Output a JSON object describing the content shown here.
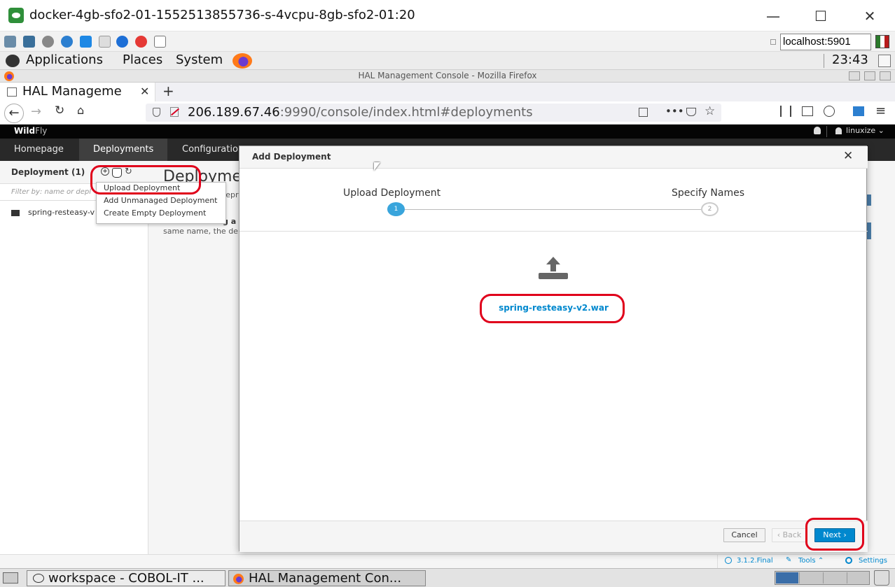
{
  "window": {
    "title": "docker-4gb-sfo2-01-1552513855736-s-4vcpu-8gb-sfo2-01:20",
    "minimize": "—",
    "maximize": "☐",
    "close": "✕"
  },
  "vnc": {
    "host": "localhost:5901"
  },
  "gnome_panel": {
    "menus": [
      "Applications",
      "Places",
      "System"
    ],
    "clock": "23:43"
  },
  "firefox": {
    "window_title": "HAL Management Console - Mozilla Firefox",
    "tab_title": "HAL Manageme",
    "url_host": "206.189.67.46",
    "url_rest": ":9990/console/index.html#deployments"
  },
  "hal": {
    "brand_strong": "Wild",
    "brand_light": "Fly",
    "user": "linuxize",
    "nav_tabs": [
      "Homepage",
      "Deployments",
      "Configuratio"
    ],
    "deployment_header": "Deployment (1)",
    "filter_placeholder": "Filter by: name or depl",
    "deployment_item": "spring-resteasy-v",
    "main_heading": "Deployme",
    "main_text_1": "repre",
    "main_text_2": "g a",
    "main_text_3": "same name, the de",
    "footer": {
      "version": "3.1.2.Final",
      "tools": "Tools",
      "settings": "Settings"
    }
  },
  "dropdown": {
    "items": [
      "Upload Deployment",
      "Add Unmanaged Deployment",
      "Create Empty Deployment"
    ]
  },
  "modal": {
    "title": "Add Deployment",
    "steps": [
      {
        "label": "Upload Deployment",
        "number": "1"
      },
      {
        "label": "Specify Names",
        "number": "2"
      }
    ],
    "filename": "spring-resteasy-v2.war",
    "cancel": "Cancel",
    "back": "‹ Back",
    "next": "Next ›"
  },
  "taskbar": {
    "items": [
      "workspace - COBOL-IT ...",
      "HAL Management Con..."
    ]
  },
  "colors": {
    "accent": "#0088ce",
    "annotation": "#e0001b",
    "dark": "#292929"
  }
}
